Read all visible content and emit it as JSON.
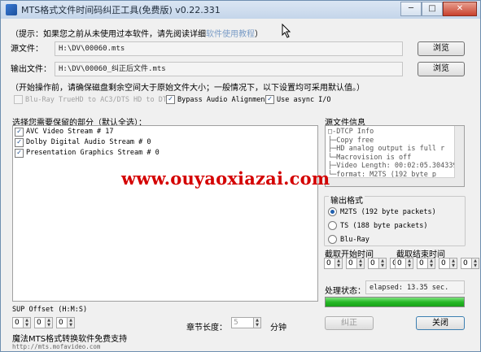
{
  "window": {
    "title": "MTS格式文件时间码纠正工具(免费版) v0.22.331",
    "minimize": "─",
    "maximize": "□",
    "close": "✕"
  },
  "hint": {
    "prefix": "（提示：如果您之前从未使用过本软件，请先阅读详细",
    "link": "软件使用教程",
    "suffix": "）"
  },
  "source": {
    "label": "源文件：",
    "value": "H:\\DV\\00060.mts",
    "browse": "浏览"
  },
  "output": {
    "label": "输出文件：",
    "value": "H:\\DV\\00060_纠正后文件.mts",
    "browse": "浏览"
  },
  "note": "（开始操作前，请确保磁盘剩余空间大于原始文件大小；一般情况下，以下设置均可采用默认值。）",
  "options": [
    {
      "label": "Blu-Ray TrueHD to AC3/DTS HD to DTS",
      "checked": false,
      "disabled": true
    },
    {
      "label": "Bypass Audio Alignment",
      "checked": true,
      "disabled": false
    },
    {
      "label": "Use async I/O",
      "checked": true,
      "disabled": false
    }
  ],
  "streams": {
    "label": "选择您需要保留的部分（默认全选）：",
    "items": [
      "AVC Video Stream # 17",
      "Dolby Digital Audio Stream # 0",
      "Presentation Graphics Stream # 0"
    ]
  },
  "info": {
    "label": "源文件信息",
    "lines": [
      "□-DTCP Info",
      "   ├─Copy free",
      "   ├─HD analog output is full r",
      "   └─Macrovision is off",
      "├─Video Length: 00:02:05.304339",
      "└─format: M2TS (192 byte p"
    ]
  },
  "format": {
    "label": "输出格式",
    "options": [
      {
        "label": "M2TS (192 byte packets)",
        "selected": true
      },
      {
        "label": "TS (188 byte packets)",
        "selected": false
      },
      {
        "label": "Blu-Ray",
        "selected": false
      }
    ]
  },
  "trim": {
    "start_label": "截取开始时间",
    "end_label": "截取结束时间",
    "start": [
      "0",
      "0",
      "0",
      "0"
    ],
    "end": [
      "0",
      "0",
      "0",
      "0"
    ]
  },
  "status": {
    "label": "处理状态：",
    "text": "elapsed: 13.35 sec.",
    "progress": 1.0
  },
  "sup": {
    "label": "SUP Offset (H:M:S)",
    "values": [
      "0",
      "0",
      "0"
    ]
  },
  "chapter": {
    "label": "章节长度：",
    "value": "5",
    "unit": "分钟"
  },
  "footer": {
    "text": "魔法MTS格式转换软件免费支持",
    "url": "http://mts.mofavideo.com"
  },
  "buttons": {
    "correct": "纠正",
    "close": "关闭"
  },
  "watermark": "www.ouyaoxiazai.com",
  "colors": {
    "accent": "#1f5fae",
    "progress": "#27b927",
    "watermark": "#d40000",
    "link": "#7a9cc6"
  }
}
